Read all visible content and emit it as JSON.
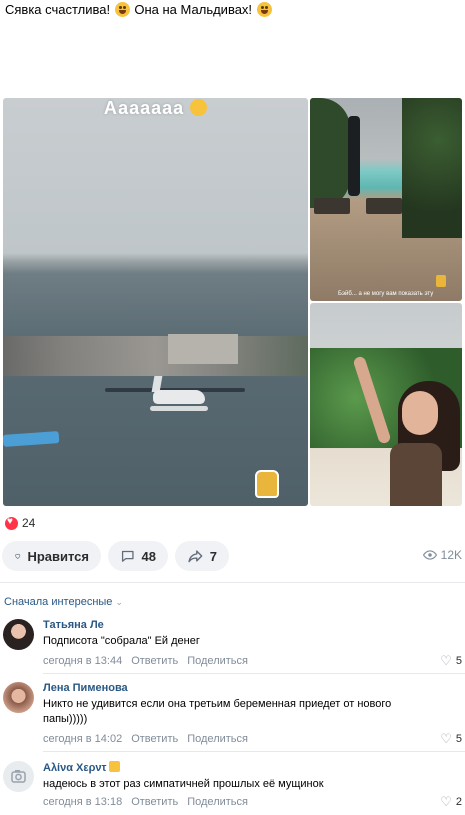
{
  "post": {
    "text_part1": "Сявка счастлива!",
    "text_part2": "Она на Мальдивах!",
    "photo_overlay_text": "Аааааaa",
    "photo_caption": "Бэйб... а не могу вам показать эту"
  },
  "stats": {
    "likes_count": "24",
    "like_button_label": "Нравится",
    "comments_count": "48",
    "shares_count": "7",
    "views_count": "12K"
  },
  "comments_header": {
    "sort_label": "Сначала интересные"
  },
  "comments": [
    {
      "author": "Татьяна Ле",
      "text": "Подписота \"собрала\" Ей денег",
      "time": "сегодня в 13:44",
      "reply_label": "Ответить",
      "share_label": "Поделиться",
      "likes": "5"
    },
    {
      "author": "Лена Пименова",
      "text": "Никто не удивится если она третьим беременная приедет от нового папы)))))",
      "time": "сегодня в 14:02",
      "reply_label": "Ответить",
      "share_label": "Поделиться",
      "likes": "5"
    },
    {
      "author": "Αλίνα Χερντ",
      "text": "надеюсь в этот раз симпатичней прошлых её мущинок",
      "time": "сегодня в 13:18",
      "reply_label": "Ответить",
      "share_label": "Поделиться",
      "likes": "2"
    }
  ],
  "colors": {
    "link": "#2a5885",
    "like_red": "#ff3347",
    "meta_gray": "#818c99",
    "button_bg": "#f0f2f5"
  }
}
